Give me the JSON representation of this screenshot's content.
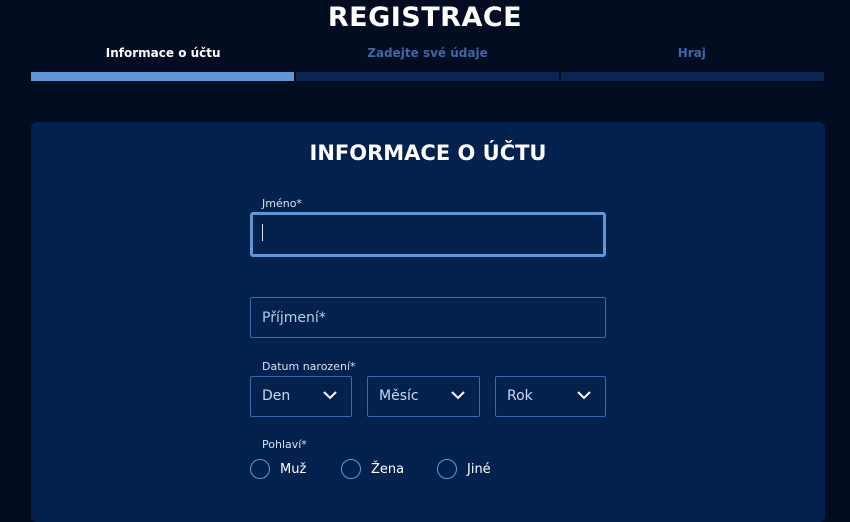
{
  "header": {
    "title": "REGISTRACE"
  },
  "steps": [
    {
      "label": "Informace o účtu",
      "active": true
    },
    {
      "label": "Zadejte své údaje",
      "active": false
    },
    {
      "label": "Hraj",
      "active": false
    }
  ],
  "form": {
    "title": "INFORMACE O ÚČTU",
    "first_name": {
      "label": "Jméno*",
      "value": ""
    },
    "last_name": {
      "placeholder": "Příjmení*",
      "value": ""
    },
    "birth_date": {
      "label": "Datum narození*",
      "day": "Den",
      "month": "Měsíc",
      "year": "Rok"
    },
    "gender": {
      "label": "Pohlaví*",
      "options": [
        "Muž",
        "Žena",
        "Jiné"
      ]
    }
  },
  "colors": {
    "background": "#020d21",
    "card": "#03214d",
    "accent": "#5f97d5",
    "border": "#3c6aa9",
    "inactive_step": "#3e67a4"
  }
}
